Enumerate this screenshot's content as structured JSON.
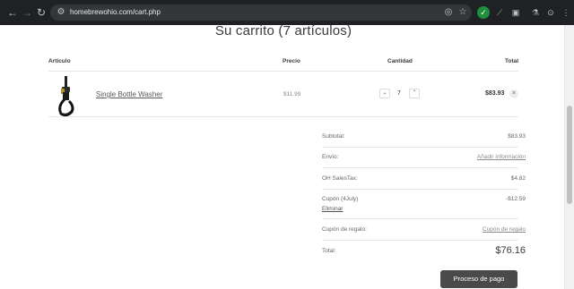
{
  "browser": {
    "url": "homebrewohio.com/cart.php",
    "back_icon": "arrow-left-icon",
    "forward_icon": "arrow-right-icon",
    "reload_icon": "reload-icon"
  },
  "cart": {
    "title": "Su carrito (7 artículos)",
    "headers": {
      "item": "Artículo",
      "price": "Precio",
      "quantity": "Cantidad",
      "total": "Total"
    },
    "items": [
      {
        "name": "Single Bottle Washer",
        "price": "$11.99",
        "quantity": "7",
        "total": "$83.93",
        "decrease": "⌄",
        "increase": "⌃",
        "remove": "×"
      }
    ]
  },
  "summary": {
    "subtotal_label": "Subtotal:",
    "subtotal_value": "$83.93",
    "shipping_label": "Envío:",
    "shipping_link": "Añadir información",
    "tax_label": "OH SalesTax:",
    "tax_value": "$4.82",
    "coupon_label": "Cupón (4July)",
    "coupon_value": "-$12.59",
    "coupon_remove": "Eliminar",
    "gift_label": "Cupón de regalo:",
    "gift_link": "Cupón de regalo",
    "total_label": "Total:",
    "total_value": "$76.16"
  },
  "checkout_label": "Proceso de pago",
  "colors": {
    "chrome": "#202124",
    "button": "#4a4a4a",
    "text": "#3a3a3a"
  }
}
